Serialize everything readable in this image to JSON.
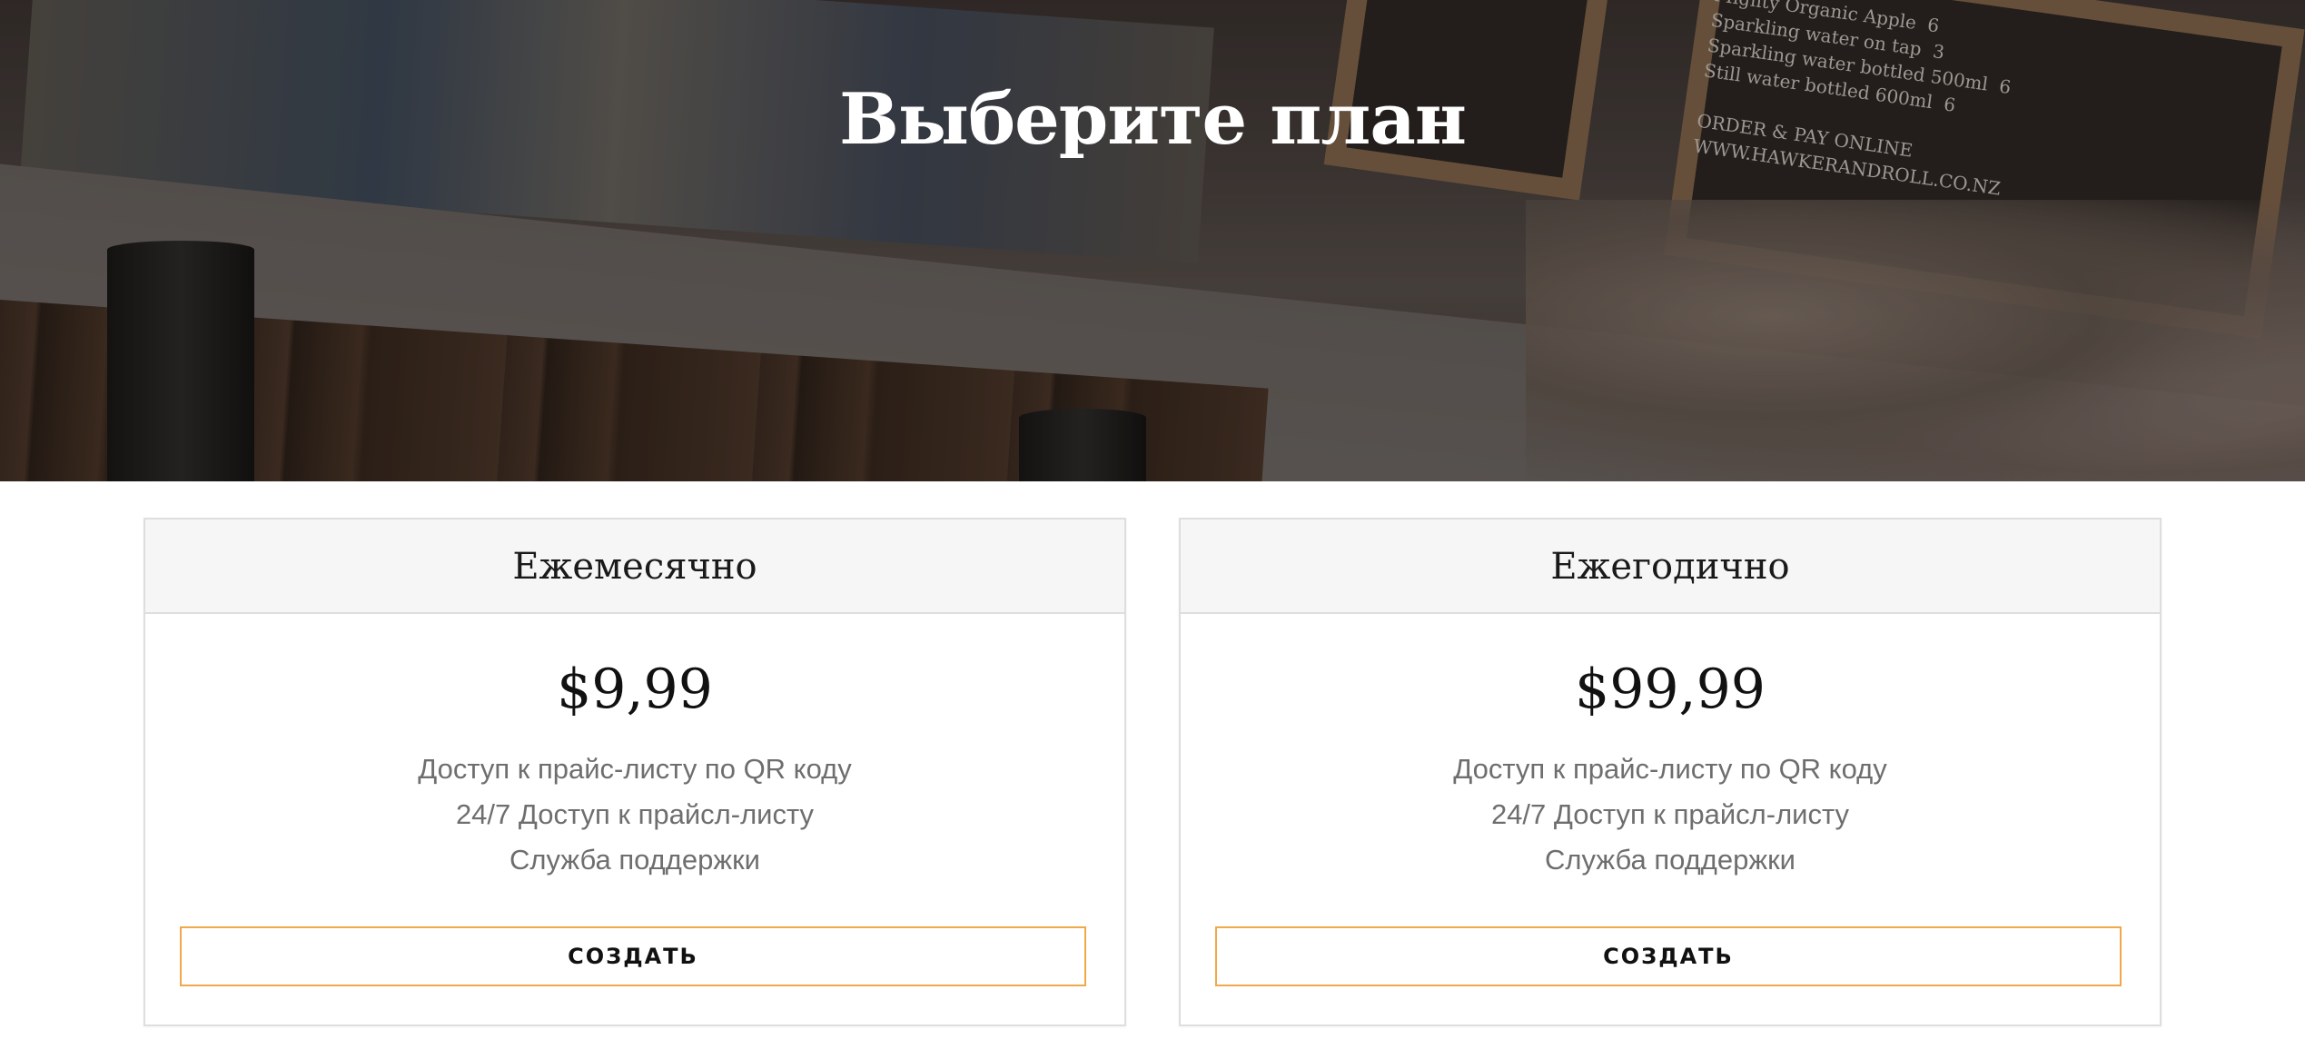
{
  "hero": {
    "title": "Выберите план",
    "background_icon": "restaurant-photo-icon",
    "menu_board_text": "Mighty Organic Apple  6\nSparkling water on tap  3\nSparkling water bottled 500ml  6\nStill water bottled 600ml  6\n\nORDER & PAY ONLINE\nWWW.HAWKERANDROLL.CO.NZ"
  },
  "plans": [
    {
      "name": "Ежемесячно",
      "price": "$9,99",
      "features": [
        "Доступ к прайс-листу по QR коду",
        "24/7 Доступ к прайсл-листу",
        "Служба поддержки"
      ],
      "button_label": "СОЗДАТЬ"
    },
    {
      "name": "Ежегодично",
      "price": "$99,99",
      "features": [
        "Доступ к прайс-листу по QR коду",
        "24/7 Доступ к прайсл-листу",
        "Служба поддержки"
      ],
      "button_label": "СОЗДАТЬ"
    }
  ],
  "colors": {
    "button_border": "#f0a849",
    "card_header_bg": "#f6f6f6",
    "feature_text": "#6e6e6e"
  }
}
